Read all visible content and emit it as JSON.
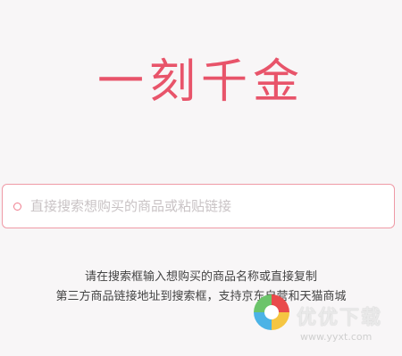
{
  "app": {
    "title": "一刻千金"
  },
  "search": {
    "placeholder": "直接搜索想购买的商品或粘贴链接",
    "value": ""
  },
  "hint": {
    "line1": "请在搜索框输入想购买的商品名称或直接复制",
    "line2": "第三方商品链接地址到搜索框，支持京东自营和天猫商城"
  },
  "watermark": {
    "title": "优优下载",
    "url": "www.yyxt.com"
  },
  "colors": {
    "accent": "#e8546a",
    "search_border": "#ef9aa6",
    "background": "#f8f6f7"
  },
  "icons": {
    "search": "search-dot-icon",
    "watermark": "watermark-logo-icon"
  }
}
